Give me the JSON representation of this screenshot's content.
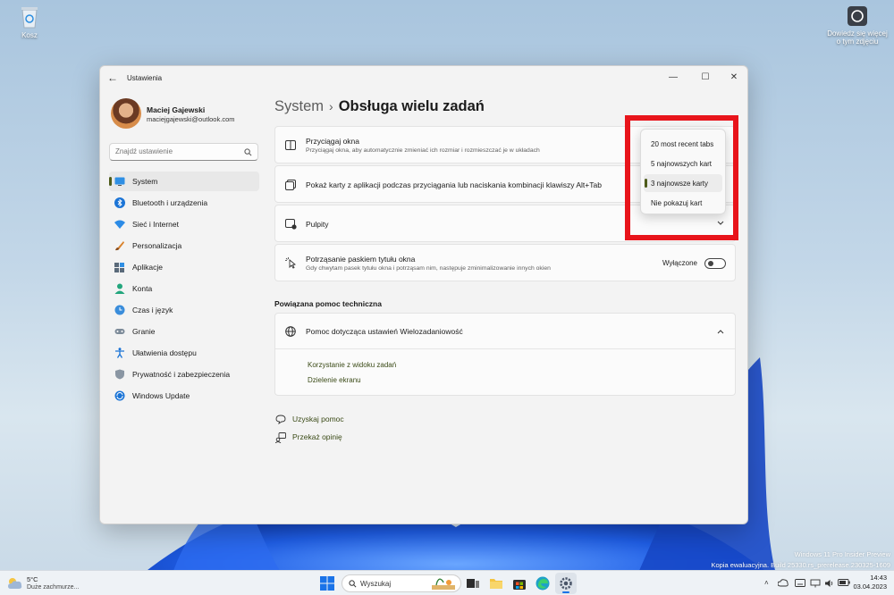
{
  "desktop": {
    "recycle_bin_label": "Kosz",
    "shortcut_label_line1": "Dowiedz się więcej",
    "shortcut_label_line2": "o tym zdjęciu",
    "watermark_line1": "Windows 11 Pro Insider Preview",
    "watermark_line2": "Kopia ewaluacyjna. Build 25330.rs_prerelease.230325-1609"
  },
  "window": {
    "title": "Ustawienia",
    "back_icon": "arrow-left-icon"
  },
  "profile": {
    "name": "Maciej Gajewski",
    "email": "maciejgajewski@outlook.com"
  },
  "search": {
    "placeholder": "Znajdź ustawienie"
  },
  "nav": {
    "items": [
      {
        "label": "System",
        "icon": "monitor-icon",
        "active": true
      },
      {
        "label": "Bluetooth i urządzenia",
        "icon": "bluetooth-icon"
      },
      {
        "label": "Sieć i Internet",
        "icon": "wifi-icon"
      },
      {
        "label": "Personalizacja",
        "icon": "brush-icon"
      },
      {
        "label": "Aplikacje",
        "icon": "apps-icon"
      },
      {
        "label": "Konta",
        "icon": "person-icon"
      },
      {
        "label": "Czas i język",
        "icon": "globe-clock-icon"
      },
      {
        "label": "Granie",
        "icon": "gamepad-icon"
      },
      {
        "label": "Ułatwienia dostępu",
        "icon": "accessibility-icon"
      },
      {
        "label": "Prywatność i zabezpieczenia",
        "icon": "shield-icon"
      },
      {
        "label": "Windows Update",
        "icon": "update-icon"
      }
    ]
  },
  "breadcrumb": {
    "parent": "System",
    "separator": "›",
    "current": "Obsługa wielu zadań"
  },
  "cards": {
    "snap": {
      "title": "Przyciągaj okna",
      "desc": "Przyciągaj okna, aby automatycznie zmieniać ich rozmiar i rozmieszczać je w układach"
    },
    "tabs": {
      "title": "Pokaż karty z aplikacji podczas przyciągania lub naciskania kombinacji klawiszy Alt+Tab"
    },
    "desktops": {
      "title": "Pulpity"
    },
    "shake": {
      "title": "Potrząsanie paskiem tytułu okna",
      "desc": "Gdy chwytam pasek tytułu okna i potrząsam nim, następuje zminimalizowanie innych okien",
      "toggle_label": "Wyłączone"
    }
  },
  "dropdown": {
    "options": [
      "20 most recent tabs",
      "5 najnowszych kart",
      "3 najnowsze karty",
      "Nie pokazuj kart"
    ],
    "selected": "3 najnowsze karty"
  },
  "related": {
    "heading": "Powiązana pomoc techniczna",
    "help_title": "Pomoc dotycząca ustawień Wielozadaniowość",
    "links": [
      "Korzystanie z widoku zadań",
      "Dzielenie ekranu"
    ]
  },
  "footer": {
    "get_help": "Uzyskaj pomoc",
    "feedback": "Przekaż opinię"
  },
  "taskbar": {
    "weather_temp": "5°C",
    "weather_desc": "Duże zachmurze...",
    "search_label": "Wyszukaj",
    "time": "14:43",
    "date": "03.04.2023"
  },
  "colors": {
    "accent": "#4e5b1a",
    "highlight_box": "#e8141b",
    "link": "#3a4a16"
  }
}
